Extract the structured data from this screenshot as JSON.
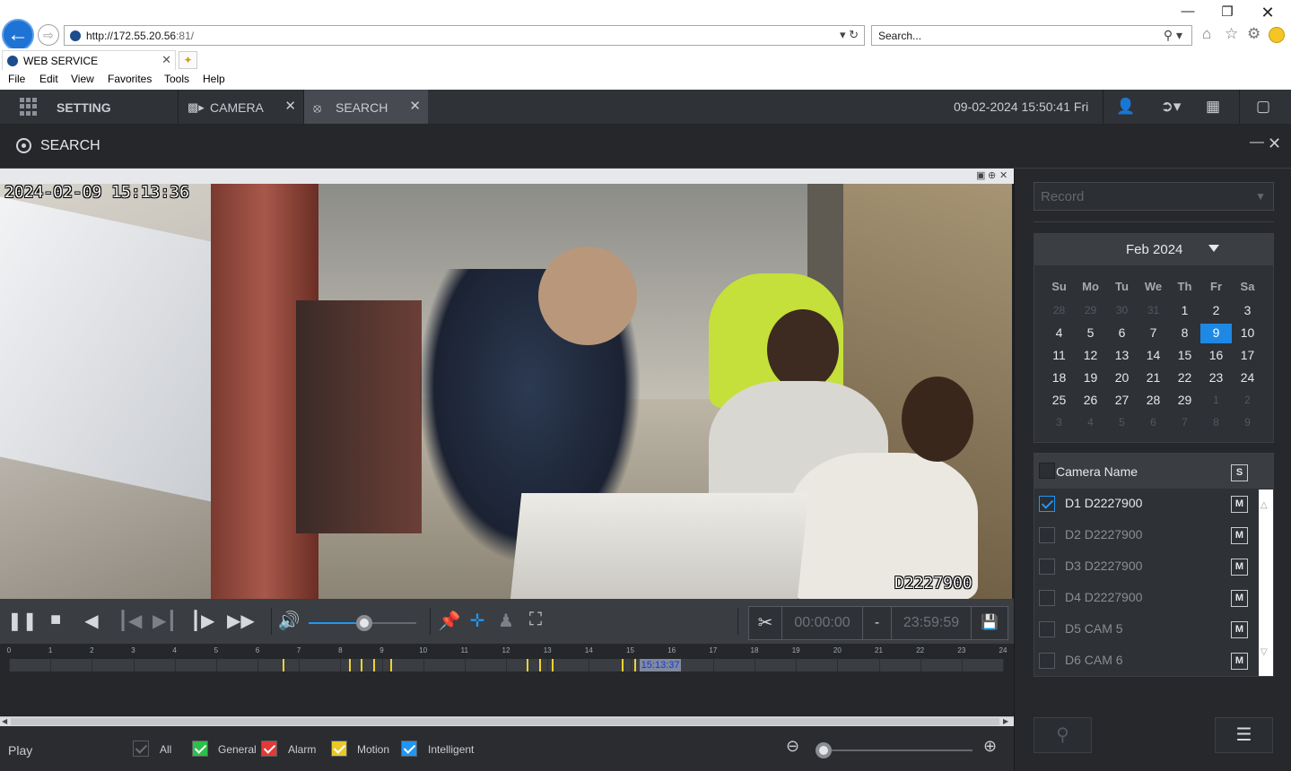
{
  "browser": {
    "url_host": "http://172.55.20.56",
    "url_port": ":81/",
    "search_placeholder": "Search...",
    "tab_title": "WEB SERVICE",
    "menu": [
      "File",
      "Edit",
      "View",
      "Favorites",
      "Tools",
      "Help"
    ]
  },
  "nav": {
    "setting_label": "SETTING",
    "tabs": [
      {
        "label": "CAMERA",
        "active": false
      },
      {
        "label": "SEARCH",
        "active": true
      }
    ],
    "datetime": "09-02-2024 15:50:41 Fri"
  },
  "search_panel": {
    "title": "SEARCH"
  },
  "video": {
    "osd_timestamp": "2024-02-09 15:13:36",
    "osd_channel": "D2227900"
  },
  "playback": {
    "volume_fraction": 0.52,
    "clip_start": "00:00:00",
    "clip_separator": "-",
    "clip_end": "23:59:59"
  },
  "timeline": {
    "hours": [
      "0",
      "1",
      "2",
      "3",
      "4",
      "5",
      "6",
      "7",
      "8",
      "9",
      "10",
      "11",
      "12",
      "13",
      "14",
      "15",
      "16",
      "17",
      "18",
      "19",
      "20",
      "21",
      "22",
      "23",
      "24"
    ],
    "motion_marks_hours": [
      6.6,
      8.2,
      8.5,
      8.8,
      9.2,
      12.5,
      12.8,
      13.1,
      14.8,
      15.1,
      15.3
    ],
    "cursor_label": "15:13:37",
    "cursor_hour": 15.22
  },
  "legend": {
    "play_label": "Play",
    "items": [
      {
        "label": "All",
        "color": "#2a2c30"
      },
      {
        "label": "General",
        "color": "#2dbf4a"
      },
      {
        "label": "Alarm",
        "color": "#e53935"
      },
      {
        "label": "Motion",
        "color": "#e8c92b"
      },
      {
        "label": "Intelligent",
        "color": "#2196f3"
      }
    ],
    "zoom_fraction": 0.0
  },
  "right": {
    "record_type": "Record",
    "calendar": {
      "title": "Feb 2024",
      "dow": [
        "Su",
        "Mo",
        "Tu",
        "We",
        "Th",
        "Fr",
        "Sa"
      ],
      "weeks": [
        [
          {
            "d": "28",
            "m": true
          },
          {
            "d": "29",
            "m": true
          },
          {
            "d": "30",
            "m": true
          },
          {
            "d": "31",
            "m": true
          },
          {
            "d": "1",
            "dot": true
          },
          {
            "d": "2",
            "dot": true
          },
          {
            "d": "3",
            "dot": true
          }
        ],
        [
          {
            "d": "4",
            "dot": true
          },
          {
            "d": "5",
            "dot": true
          },
          {
            "d": "6",
            "dot": true
          },
          {
            "d": "7",
            "dot": true
          },
          {
            "d": "8",
            "dot": true
          },
          {
            "d": "9",
            "dot": true,
            "sel": true
          },
          {
            "d": "10"
          }
        ],
        [
          {
            "d": "11"
          },
          {
            "d": "12"
          },
          {
            "d": "13"
          },
          {
            "d": "14"
          },
          {
            "d": "15"
          },
          {
            "d": "16"
          },
          {
            "d": "17"
          }
        ],
        [
          {
            "d": "18"
          },
          {
            "d": "19"
          },
          {
            "d": "20"
          },
          {
            "d": "21"
          },
          {
            "d": "22"
          },
          {
            "d": "23"
          },
          {
            "d": "24"
          }
        ],
        [
          {
            "d": "25"
          },
          {
            "d": "26"
          },
          {
            "d": "27"
          },
          {
            "d": "28"
          },
          {
            "d": "29"
          },
          {
            "d": "1",
            "m": true
          },
          {
            "d": "2",
            "m": true
          }
        ],
        [
          {
            "d": "3",
            "m": true
          },
          {
            "d": "4",
            "m": true
          },
          {
            "d": "5",
            "m": true
          },
          {
            "d": "6",
            "m": true
          },
          {
            "d": "7",
            "m": true
          },
          {
            "d": "8",
            "m": true
          },
          {
            "d": "9",
            "m": true
          }
        ]
      ]
    },
    "camera_list": {
      "header": "Camera Name",
      "s_label": "S",
      "m_label": "M",
      "cameras": [
        {
          "name": "D1 D2227900",
          "checked": true
        },
        {
          "name": "D2 D2227900",
          "checked": false
        },
        {
          "name": "D3 D2227900",
          "checked": false
        },
        {
          "name": "D4 D2227900",
          "checked": false
        },
        {
          "name": "D5 CAM 5",
          "checked": false
        },
        {
          "name": "D6 CAM 6",
          "checked": false
        }
      ]
    }
  }
}
